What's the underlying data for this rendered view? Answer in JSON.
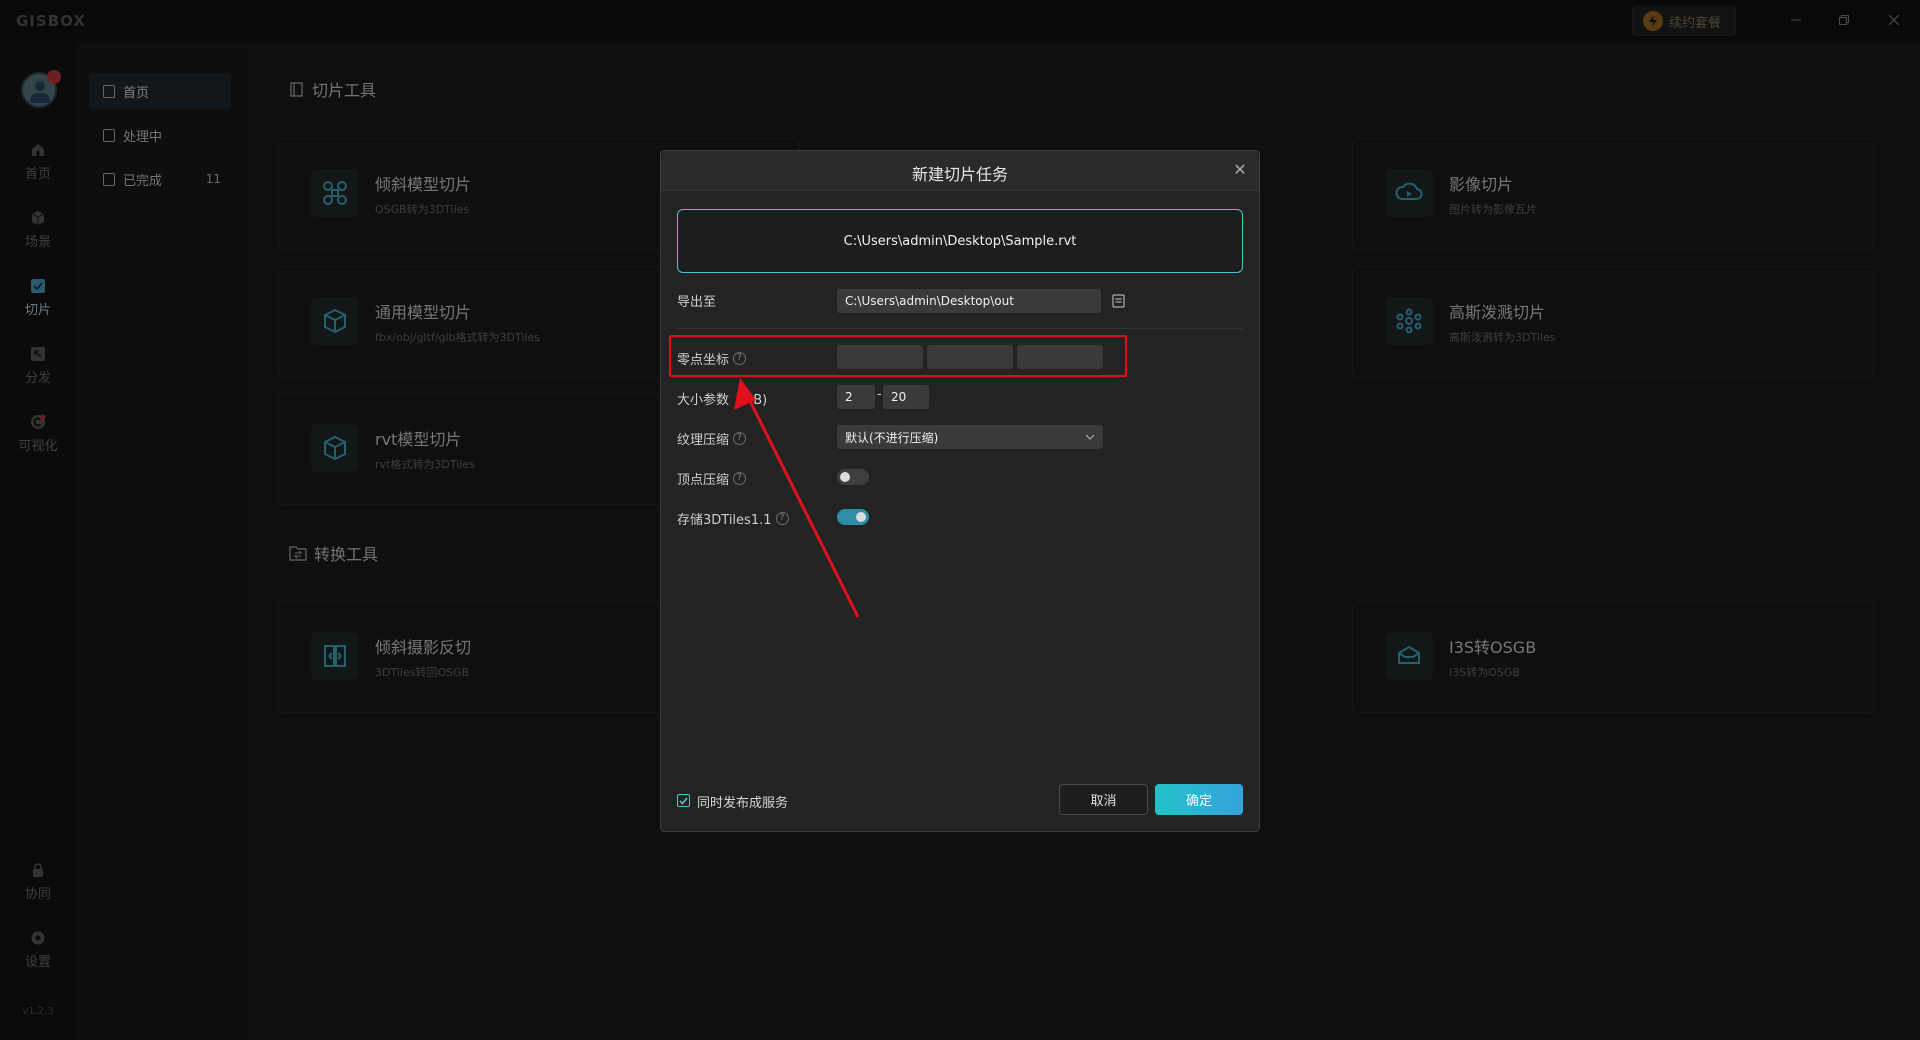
{
  "app": {
    "logo": "GISBOX",
    "version": "v1.2.3"
  },
  "titlebar": {
    "renew_label": "续约套餐"
  },
  "leftnav": {
    "items": [
      {
        "label": "首页",
        "icon": "home-icon"
      },
      {
        "label": "场景",
        "icon": "cube-icon"
      },
      {
        "label": "切片",
        "icon": "slice-icon"
      },
      {
        "label": "分发",
        "icon": "distribute-icon"
      },
      {
        "label": "可视化",
        "icon": "visual-icon"
      }
    ],
    "bottom": [
      {
        "label": "协同",
        "icon": "lock-icon"
      },
      {
        "label": "设置",
        "icon": "gear-icon"
      }
    ]
  },
  "subnav": {
    "items": [
      {
        "label": "首页"
      },
      {
        "label": "处理中"
      },
      {
        "label": "已完成",
        "count": "11"
      }
    ]
  },
  "main": {
    "slice_section": "切片工具",
    "convert_section": "转换工具",
    "cards": [
      {
        "title": "倾斜模型切片",
        "subtitle": "OSGB转为3DTiles"
      },
      {
        "title": "影像切片",
        "subtitle": "图片转为影像瓦片"
      },
      {
        "title": "通用模型切片",
        "subtitle": "fbx/obj/gltf/glb格式转为3DTiles"
      },
      {
        "title": "高斯泼溅切片",
        "subtitle": "高斯泼溅转为3DTiles"
      },
      {
        "title": "rvt模型切片",
        "subtitle": "rvt格式转为3DTiles"
      },
      {
        "title": "倾斜摄影反切",
        "subtitle": "3DTiles转回OSGB"
      },
      {
        "title": "I3S转OSGB",
        "subtitle": "I3S转为OSGB"
      }
    ]
  },
  "dialog": {
    "title": "新建切片任务",
    "file_path": "C:\\Users\\admin\\Desktop\\Sample.rvt",
    "export_label": "导出至",
    "export_path": "C:\\Users\\admin\\Desktop\\out",
    "origin_label": "零点坐标",
    "origin_x": "",
    "origin_y": "",
    "origin_z": "",
    "size_label": "大小参数（MB)",
    "size_min": "2",
    "size_sep": "-",
    "size_max": "20",
    "texture_label": "纹理压缩",
    "texture_value": "默认(不进行压缩)",
    "vertex_label": "顶点压缩",
    "vertex_on": false,
    "store_label": "存储3DTiles1.1",
    "store_on": true,
    "publish_label": "同时发布成服务",
    "publish_checked": true,
    "cancel_label": "取消",
    "ok_label": "确定",
    "close_glyph": "✕",
    "help_glyph": "?"
  },
  "colors": {
    "accent": "#4ec4cf",
    "highlight_box": "#e0101a",
    "arrow": "#e0101a"
  }
}
